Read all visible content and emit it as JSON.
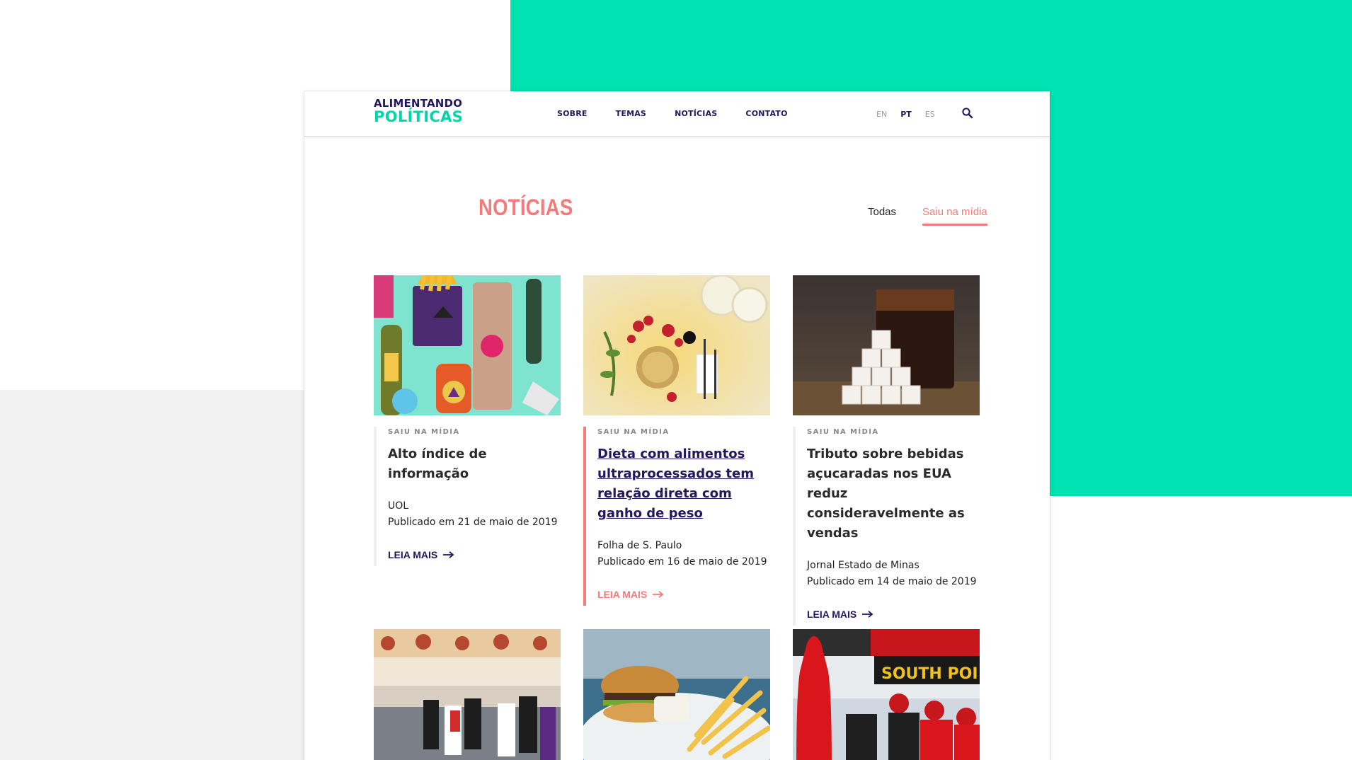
{
  "header": {
    "logo_line1": "ALIMENTANDO",
    "logo_line2": "POLÍTICAS",
    "nav": [
      "SOBRE",
      "TEMAS",
      "NOTÍCIAS",
      "CONTATO"
    ],
    "languages": [
      "EN",
      "PT",
      "ES"
    ],
    "active_language": "PT",
    "search_icon": "search-icon"
  },
  "main": {
    "title": "NOTÍCIAS",
    "filters": {
      "all": "Todas",
      "media": "Saiu na mídia"
    },
    "active_filter": "Saiu na mídia"
  },
  "cards": [
    {
      "category": "SAIU NA MÍDIA",
      "title": "Alto índice de informação",
      "source": "UOL",
      "date": "Publicado em 21 de maio de 2019",
      "read_more": "LEIA MAIS"
    },
    {
      "category": "SAIU NA MÍDIA",
      "title": "Dieta com alimentos ultraprocessados tem relação direta com ganho de peso",
      "source": "Folha de S. Paulo",
      "date": "Publicado em 16 de maio de 2019",
      "read_more": "LEIA MAIS"
    },
    {
      "category": "SAIU NA MÍDIA",
      "title": "Tributo sobre bebidas açucaradas nos EUA reduz consideravelmente as vendas",
      "source": "Jornal Estado de Minas",
      "date": "Publicado em 14 de maio de 2019",
      "read_more": "LEIA MAIS"
    }
  ],
  "colors": {
    "accent": "#f47b7b",
    "brand": "#25175f",
    "green": "#00e2b0"
  }
}
